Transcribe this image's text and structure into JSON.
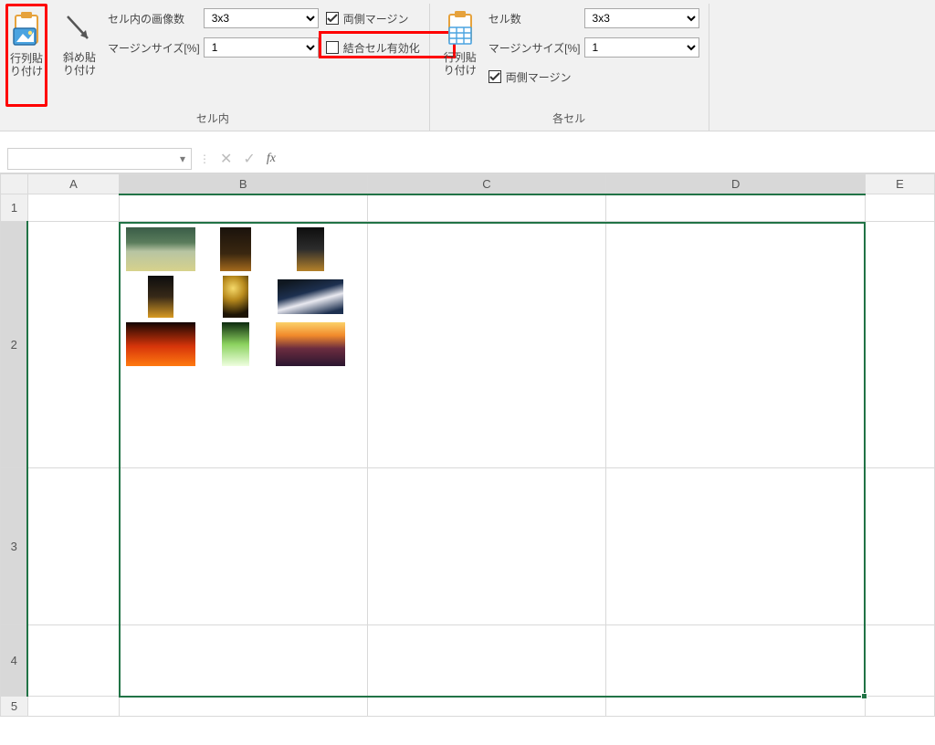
{
  "ribbon": {
    "group_cellin": {
      "label": "セル内",
      "matrix_paste_btn": "行列貼\nり付け",
      "diag_paste_btn": "斜め貼\nり付け",
      "img_count_label": "セル内の画像数",
      "margin_size_label": "マージンサイズ[%]",
      "both_margin_label": "両側マージン",
      "merge_cell_label": "結合セル有効化",
      "img_count_value": "3x3",
      "margin_size_value": "1"
    },
    "group_eachcell": {
      "label": "各セル",
      "matrix_paste_btn": "行列貼\nり付け",
      "cell_count_label": "セル数",
      "margin_size_label": "マージンサイズ[%]",
      "both_margin_label": "両側マージン",
      "cell_count_value": "3x3",
      "margin_size_value": "1"
    }
  },
  "formula_bar": {
    "name_box": "",
    "fx_label": "fx",
    "formula": ""
  },
  "grid": {
    "columns": [
      "A",
      "B",
      "C",
      "D",
      "E"
    ],
    "rows": [
      "1",
      "2",
      "3",
      "4",
      "5"
    ],
    "selected_range": "B2:D4"
  },
  "images": {
    "names": [
      "landscape-hills",
      "night-lantern",
      "dark-dog",
      "night-alley",
      "moon-roof",
      "branches-sky",
      "torii-red",
      "green-forest",
      "sunset-sky"
    ]
  },
  "checkboxes": {
    "both_margin_1": true,
    "merge_cell": false,
    "both_margin_2": true
  }
}
